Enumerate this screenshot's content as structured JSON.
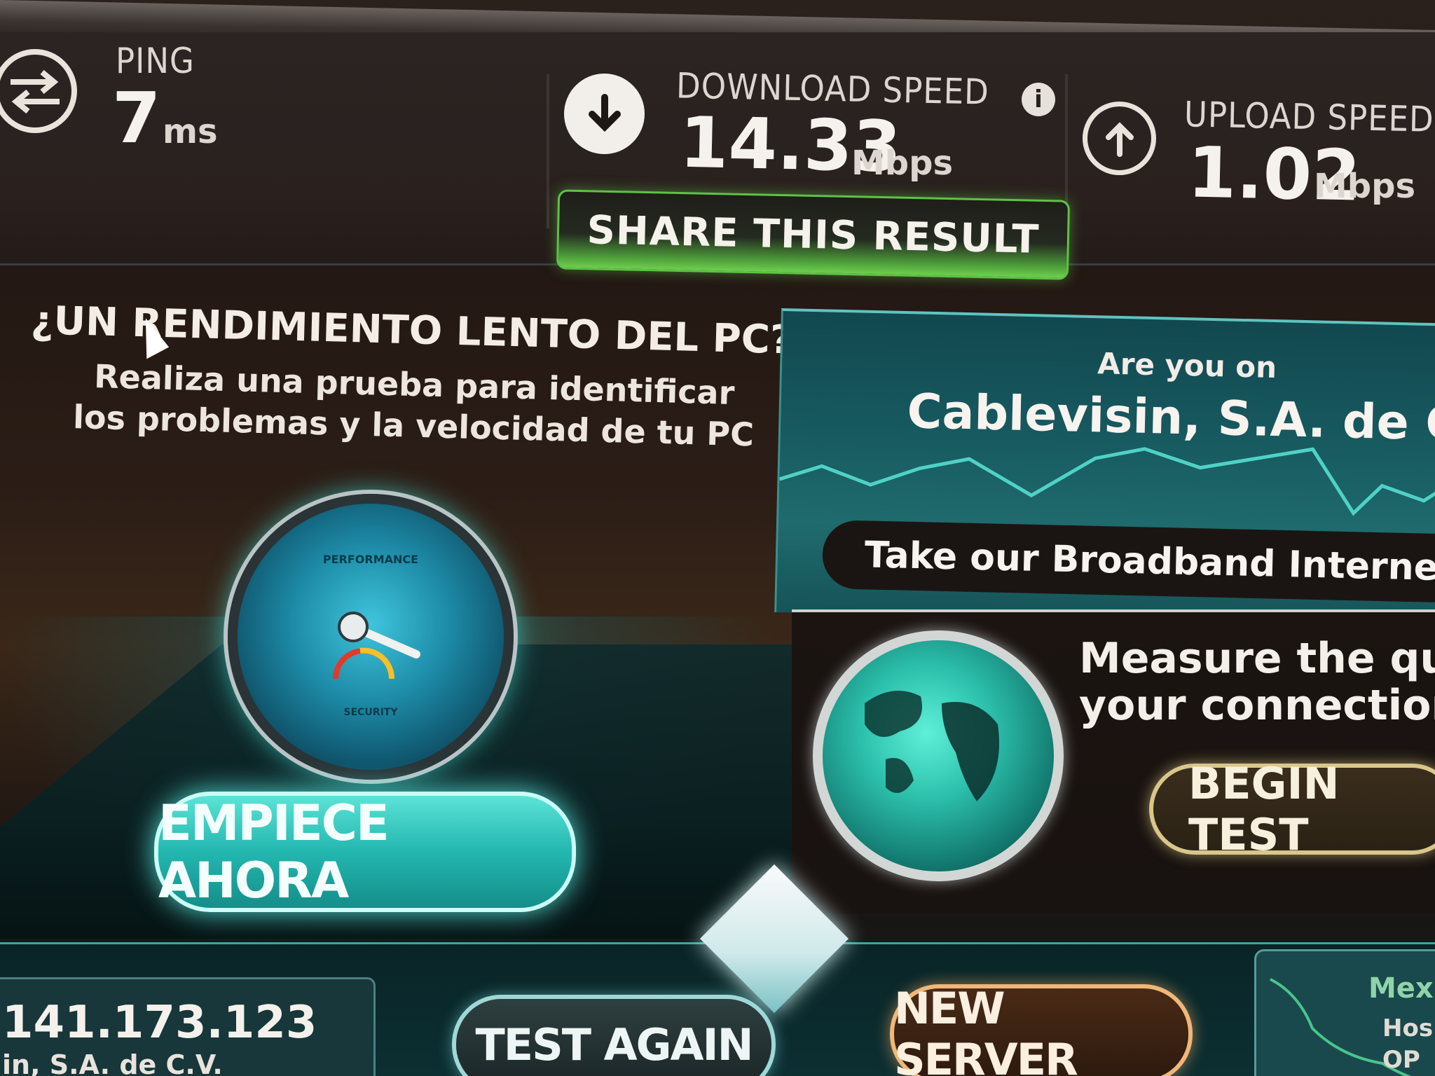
{
  "results": {
    "ping": {
      "label": "PING",
      "value": "7",
      "unit": "ms"
    },
    "download": {
      "label": "DOWNLOAD SPEED",
      "value": "14.33",
      "unit": "Mbps"
    },
    "upload": {
      "label": "UPLOAD SPEED",
      "value": "1.02",
      "unit": "Mbps"
    },
    "share_label": "SHARE THIS RESULT"
  },
  "promo": {
    "title": "¿UN RENDIMIENTO LENTO DEL PC?",
    "line1": "Realiza una prueba para identificar",
    "line2": "los problemas y la velocidad de tu PC",
    "gauge_top": "PERFORMANCE",
    "gauge_bottom": "SECURITY",
    "button": "EMPIECE AHORA"
  },
  "isp": {
    "question": "Are you on",
    "name": "Cablevisin, S.A. de C.V.?",
    "survey": "Take our Broadband Internet Surv"
  },
  "measure": {
    "line1": "Measure the qualit",
    "line2": "your connection.",
    "button": "BEGIN TEST"
  },
  "footer": {
    "ip": "141.173.123",
    "isp": "in, S.A. de C.V.",
    "test_again": "TEST AGAIN",
    "new_server": "NEW SERVER",
    "map_label": "Mexic",
    "host_label": "Hos",
    "op_label": "OP"
  },
  "colors": {
    "accent_green": "#5fc246",
    "accent_teal": "#23b7b0",
    "accent_gold": "#d9c68a"
  }
}
